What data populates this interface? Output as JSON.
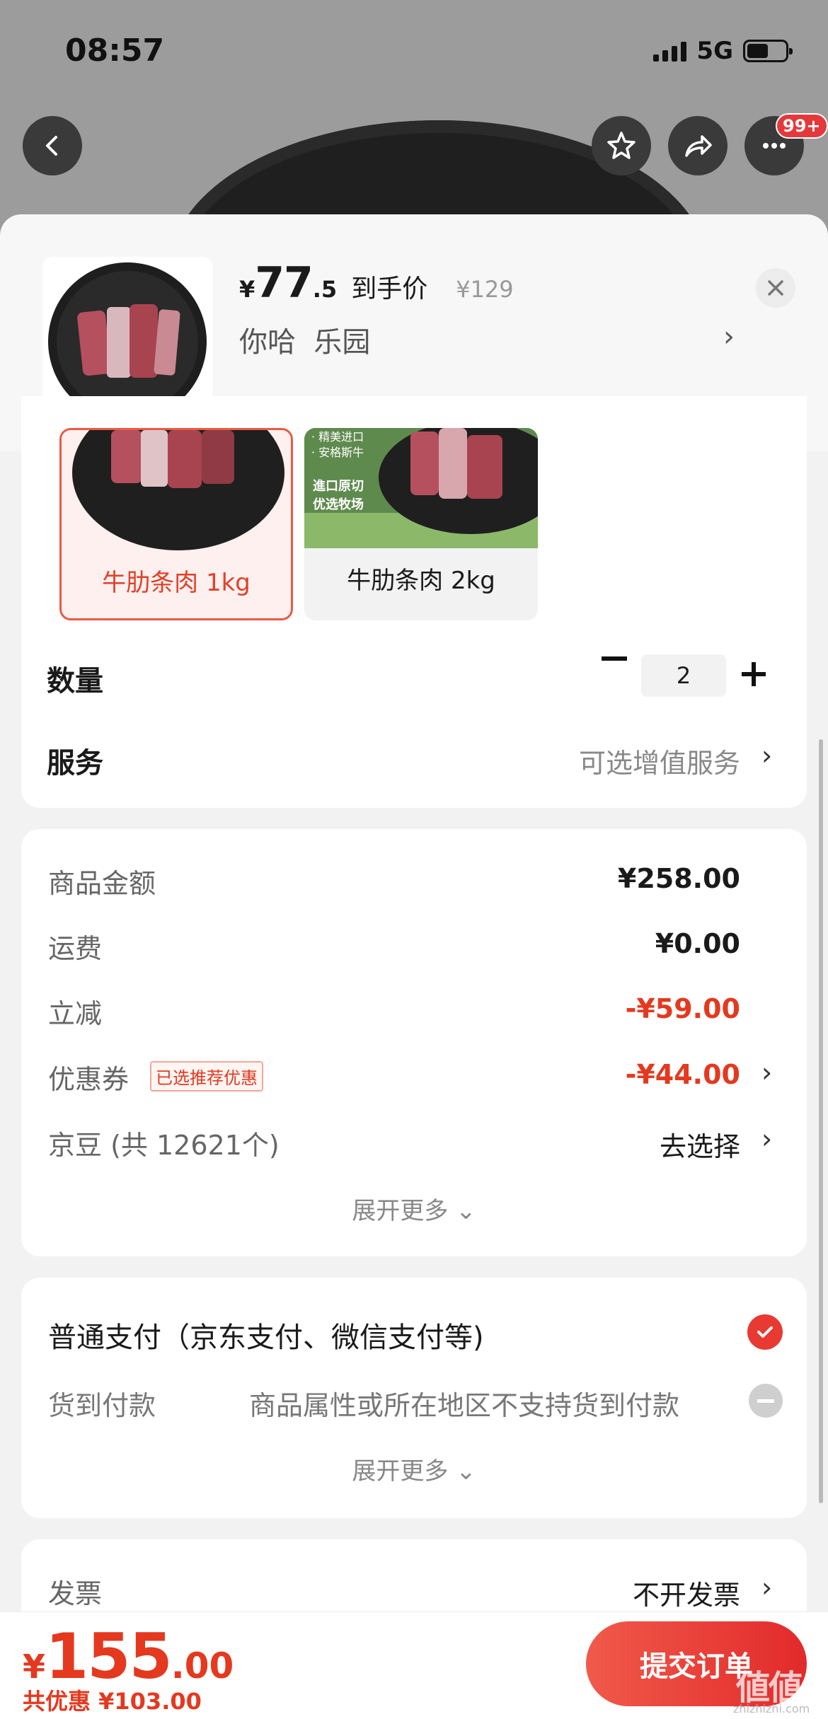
{
  "status_bar": {
    "time": "08:57",
    "network": "5G",
    "battery_level": 0.55
  },
  "nav": {
    "badge": "99+",
    "icons": [
      "back-icon",
      "star-icon",
      "share-icon",
      "more-icon"
    ]
  },
  "summary": {
    "price_currency": "¥",
    "price_int": "77",
    "price_dec": ".5",
    "price_tag": "到手价",
    "original_price": "¥129",
    "variant": "你哈  乐园",
    "chevron": "›"
  },
  "specs": {
    "options": [
      {
        "label": "牛肋条肉 1kg",
        "selected": true
      },
      {
        "label": "牛肋条肉 2kg",
        "selected": false
      }
    ],
    "option2_image_text": [
      "· 精美进口",
      "· 安格斯牛",
      "進口原切",
      "优选牧场"
    ]
  },
  "quantity": {
    "label": "数量",
    "value": "2"
  },
  "service": {
    "label": "服务",
    "value": "可选增值服务",
    "chevron": "›"
  },
  "amounts": {
    "rows": [
      {
        "label": "商品金额",
        "value": "¥258.00"
      },
      {
        "label": "运费",
        "value": "¥0.00"
      },
      {
        "label": "立减",
        "value": "-¥59.00"
      },
      {
        "label": "优惠券",
        "value": "-¥44.00"
      },
      {
        "label": "京豆 (共 12621个)",
        "value": "去选择"
      }
    ],
    "coupon_tag": "已选推荐优惠",
    "expand": "展开更多 ⌄"
  },
  "payment": {
    "normal_label": "普通支付（京东支付、微信支付等)",
    "cod_label": "货到付款",
    "cod_note": "商品属性或所在地区不支持货到付款",
    "expand": "展开更多 ⌄"
  },
  "invoice": {
    "label": "发票",
    "value": "不开发票",
    "chevron": "›"
  },
  "bottom": {
    "total_currency": "¥",
    "total_int": "155",
    "total_dec": ".00",
    "saved": "共优惠 ¥103.00",
    "submit": "提交订单"
  },
  "watermark": {
    "main": "値値値",
    "sub": "zhizhizhi.com"
  },
  "colors": {
    "accent": "#e4391f",
    "submit": "#e22a2a",
    "background": "#f2f2f2"
  }
}
